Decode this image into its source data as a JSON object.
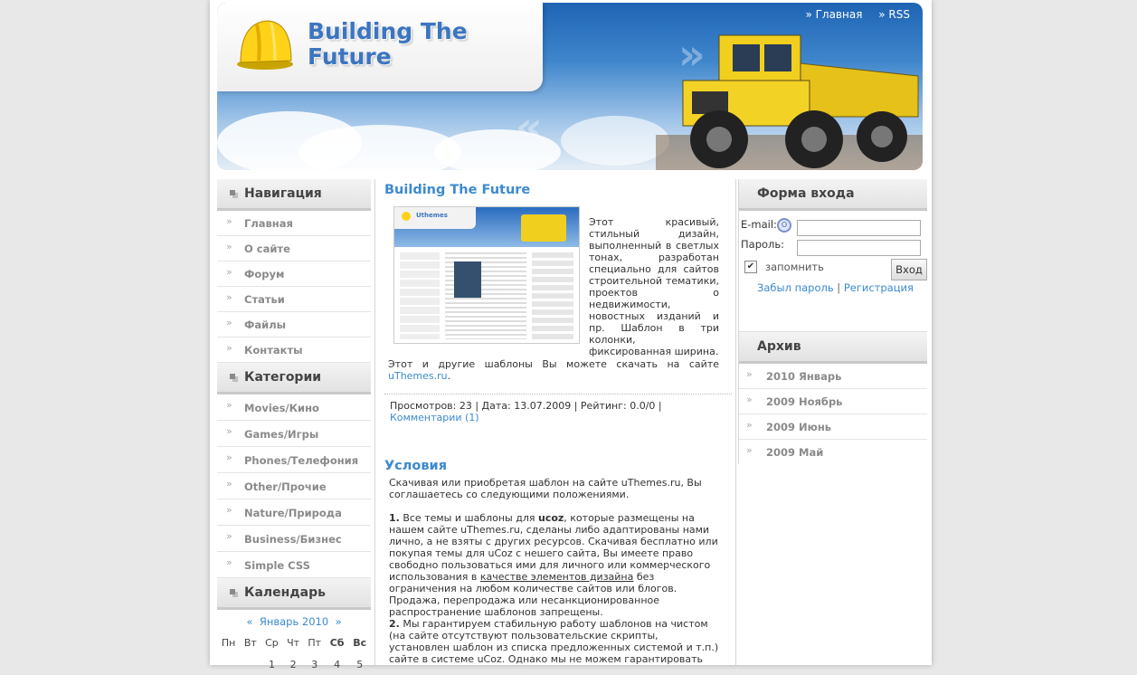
{
  "header": {
    "site_title": "Building The Future",
    "top_links": [
      "Главная",
      "RSS"
    ]
  },
  "navigation": {
    "title": "Навигация",
    "items": [
      "Главная",
      "О сайте",
      "Форум",
      "Статьи",
      "Файлы",
      "Контакты"
    ]
  },
  "categories": {
    "title": "Категории",
    "items": [
      "Movies/Кино",
      "Games/Игры",
      "Phones/Телефония",
      "Other/Прочие",
      "Nature/Природа",
      "Business/Бизнес",
      "Simple CSS"
    ]
  },
  "calendar": {
    "title": "Календарь",
    "prev": "«",
    "month": "Январь 2010",
    "next": "»",
    "weekdays": [
      "Пн",
      "Вт",
      "Ср",
      "Чт",
      "Пт",
      "Сб",
      "Вс"
    ],
    "first_row": [
      "",
      "",
      "",
      "",
      "1",
      "2",
      "3"
    ],
    "second_row_partial": [
      "",
      "",
      "1",
      "2",
      "3",
      "4",
      "5"
    ]
  },
  "post": {
    "title": "Building The Future",
    "text_side": "Этот красивый, стильный дизайн, выполненный в светлых тонах, разработан специально для сайтов строительной тематики, проектов о недвижимости, новостных изданий и пр. Шаблон в три колонки, фиксированная ширина.",
    "text_bottom_prefix": "Этот и другие шаблоны Вы можете скачать на сайте ",
    "text_bottom_link": "uThemes.ru",
    "text_bottom_suffix": ".",
    "meta_text": "Просмотров: 23 | Дата: 13.07.2009 | Рейтинг: 0.0/0 |",
    "meta_link": "Комментарии (1)"
  },
  "terms": {
    "title": "Условия",
    "intro": "Скачивая или приобретая шаблон на сайте uThemes.ru, Вы соглашаетесь со следующими положениями.",
    "p1_num": "1.",
    "p1_a": " Все темы и шаблоны для ",
    "p1_bold": "ucoz",
    "p1_b": ", которые размещены на нашем сайте uThemes.ru, сделаны либо адаптированы нами лично, а не взяты с других ресурсов. Скачивая бесплатно или покупая темы для uCoz с нешего сайта, Вы имеете право свободно пользоваться ими для личного или коммерческого использования в ",
    "p1_underline": "качестве элементов дизайна",
    "p1_c": " без ограничения на любом количестве сайтов или блогов. Продажа, перепродажа или несанкционированное распространение шаблонов запрещены.",
    "p2_num": "2.",
    "p2": " Мы гарантируем стабильную работу шаблонов на чистом (на сайте отсутствуют пользовательские скрипты, установлен шаблон из списка предложенных системой и т.п.) сайте в системе uCoz. Однако мы не можем гарантировать"
  },
  "login": {
    "title": "Форма входа",
    "email_label": "E-mail:",
    "password_label": "Пароль:",
    "remember_label": "запомнить",
    "submit": "Вход",
    "forgot": "Забыл пароль",
    "separator": "|",
    "register": "Регистрация"
  },
  "archive": {
    "title": "Архив",
    "items": [
      "2010 Январь",
      "2009 Ноябрь",
      "2009 Июнь",
      "2009 Май"
    ]
  }
}
